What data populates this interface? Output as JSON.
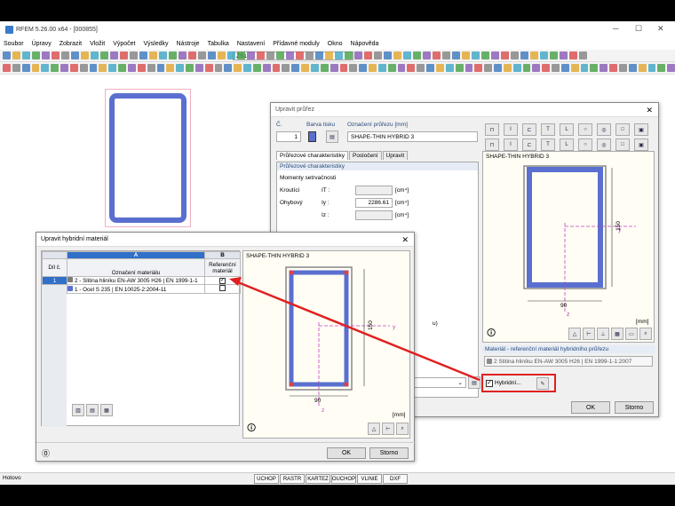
{
  "app": {
    "title": "RFEM 5.26.00 x64 - [000855]",
    "menu": [
      "Soubor",
      "Úpravy",
      "Zobrazit",
      "Vložit",
      "Výpočet",
      "Výsledky",
      "Nástroje",
      "Tabulka",
      "Nastavení",
      "Přídavné moduly",
      "Okno",
      "Nápověda"
    ],
    "toolbar_combo": "ZS1",
    "status_text": "Hotovo",
    "status_buttons": [
      "UCHOP",
      "RASTR",
      "KARTEZ",
      "OUCHOP",
      "VLINIE",
      "DXF"
    ]
  },
  "edit_section": {
    "title": "Upravit průřez",
    "no_label": "Č.",
    "no_value": "1",
    "color_label": "Barva tisku",
    "name_label": "Označení průřezu [mm]",
    "name_value": "SHAPE-THIN HYBRID 3",
    "tabs": [
      "Průřezové charakteristiky",
      "Posločení",
      "Upravit"
    ],
    "section_header": "Průřezové charakteristiky",
    "group_label": "Momenty setrvačnosti",
    "rows": [
      {
        "label": "Kroutící",
        "symbol": "IT :",
        "value": "",
        "unit": "[cm⁴]"
      },
      {
        "label": "Ohybový",
        "symbol": "Iy :",
        "value": "2286.61",
        "unit": "[cm⁴]"
      },
      {
        "label": "",
        "symbol": "Iz :",
        "value": "",
        "unit": "[cm⁴]"
      }
    ],
    "preview_title": "SHAPE-THIN HYBRID 3",
    "dim_height": "150",
    "dim_width": "90",
    "unit_mm": "[mm]",
    "ref_section_label": "Materiál - referenční materiál hybridního průřezu",
    "ref_material_value": "2 Slitina hliníku EN-AW 3005 H26 | EN 1999-1-1:2007",
    "hybrid_checkbox_label": "Hybridní...",
    "ok": "OK",
    "cancel": "Storno",
    "tail_label": "u)"
  },
  "hybrid_material": {
    "title": "Upravit hybridní materiál",
    "col_letters": [
      "A",
      "B"
    ],
    "col_headers": [
      "Díl č.",
      "Označení materiálu",
      "Referenční materiál"
    ],
    "rows": [
      {
        "no": "1",
        "material": "2 - Slitina hliníku EN-AW 3005 H26 | EN 1999-1-1",
        "ref": true,
        "color": "#7a7a7a"
      },
      {
        "no": "2",
        "material": "1 - Ocel S 235 | EN 10025-2:2004-11",
        "ref": false,
        "color": "#5a6fd0"
      }
    ],
    "preview_title": "SHAPE-THIN HYBRID 3",
    "dim_height": "150",
    "dim_width": "90",
    "unit_mm": "[mm]",
    "axis_y": "y",
    "axis_z": "z",
    "ok": "OK",
    "cancel": "Storno"
  },
  "colors": {
    "accent_red": "#e02020",
    "section_blue": "#5a6fd0",
    "select_blue": "#3070c8"
  }
}
